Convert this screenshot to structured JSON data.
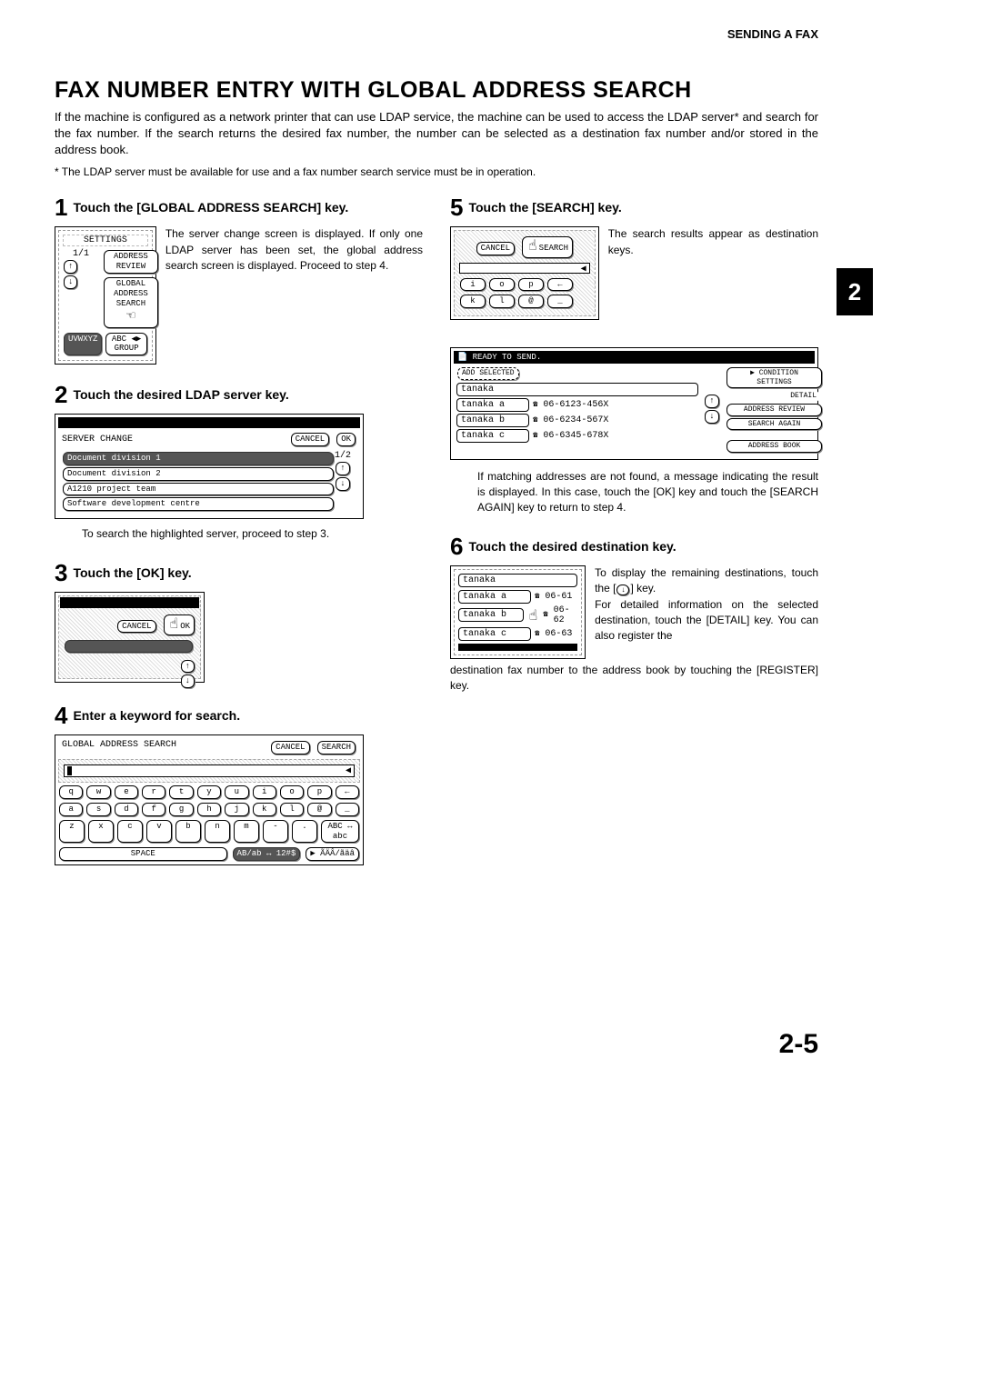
{
  "header": "SENDING A FAX",
  "title": "FAX NUMBER ENTRY WITH GLOBAL ADDRESS SEARCH",
  "intro1": "If the machine is configured as a network printer that can use LDAP service, the machine can be used to access the LDAP server* and search for the fax number. If the search returns the desired fax number, the number can be selected as a destination fax number and/or stored in the address book.",
  "intro2": "* The LDAP server must be available for use and a fax number search service must be in operation.",
  "sideTab": "2",
  "pageNumber": "2-5",
  "steps": {
    "s1": {
      "num": "1",
      "title": "Touch the [GLOBAL ADDRESS SEARCH] key.",
      "text": "The server change screen is displayed. If only one LDAP server has been set, the global address search screen is displayed. Proceed to step 4.",
      "scr": {
        "settings": "SETTINGS",
        "page": "1/1",
        "addrReview": "ADDRESS REVIEW",
        "global": "GLOBAL ADDRESS SEARCH",
        "uvwxyz": "UVWXYZ",
        "abc": "ABC",
        "group": "GROUP"
      }
    },
    "s2": {
      "num": "2",
      "title": "Touch the desired LDAP server key.",
      "text": "To search the highlighted server, proceed to step 3.",
      "scr": {
        "title": "SERVER CHANGE",
        "cancel": "CANCEL",
        "ok": "OK",
        "page": "1/2",
        "items": [
          "Document division 1",
          "Document division 2",
          "A1210 project team",
          "Software development centre"
        ]
      }
    },
    "s3": {
      "num": "3",
      "title": "Touch the [OK] key.",
      "scr": {
        "cancel": "CANCEL",
        "ok": "OK"
      }
    },
    "s4": {
      "num": "4",
      "title": "Enter a keyword for search.",
      "scr": {
        "title": "GLOBAL ADDRESS SEARCH",
        "cancel": "CANCEL",
        "search": "SEARCH",
        "rows": [
          [
            "q",
            "w",
            "e",
            "r",
            "t",
            "y",
            "u",
            "i",
            "o",
            "p",
            "←"
          ],
          [
            "a",
            "s",
            "d",
            "f",
            "g",
            "h",
            "j",
            "k",
            "l",
            "@",
            "_"
          ],
          [
            "z",
            "x",
            "c",
            "v",
            "b",
            "n",
            "m",
            "-",
            ".",
            "ABC ↔ abc"
          ]
        ],
        "space": "SPACE",
        "toggle1": "AB/ab ↔ 12#$",
        "toggle2": "▶ ÃÄÂ/ãäâ"
      }
    },
    "s5": {
      "num": "5",
      "title": "Touch the [SEARCH] key.",
      "text": "The search results appear as destination keys.",
      "scr": {
        "cancel": "CANCEL",
        "search": "SEARCH",
        "keys": [
          "i",
          "o",
          "p",
          "←",
          "k",
          "l",
          "@",
          "_"
        ]
      },
      "res": {
        "status": "READY TO SEND.",
        "addSel": "ADD SELECTED",
        "cond": "CONDITION SETTINGS",
        "query": "tanaka",
        "detail": "DETAIL",
        "addrReview": "ADDRESS REVIEW",
        "searchAgain": "SEARCH AGAIN",
        "addrBook": "ADDRESS BOOK",
        "rows": [
          {
            "n": "tanaka a",
            "p": "06-6123-456X"
          },
          {
            "n": "tanaka b",
            "p": "06-6234-567X"
          },
          {
            "n": "tanaka c",
            "p": "06-6345-678X"
          }
        ]
      },
      "after": "If matching addresses are not found, a message indicating the result is displayed. In this case, touch the [OK] key and touch the [SEARCH AGAIN] key to return to step 4."
    },
    "s6": {
      "num": "6",
      "title": "Touch the desired destination key.",
      "text1": "To display the remaining destinations, touch the [",
      "text1b": "] key.",
      "text2": "For detailed information on the selected destination, touch the [DETAIL] key. You can also register the destination fax number to the address book by touching the [REGISTER] key.",
      "scr": {
        "query": "tanaka",
        "rows": [
          {
            "n": "tanaka a",
            "p": "06-61"
          },
          {
            "n": "tanaka b",
            "p": "06-62"
          },
          {
            "n": "tanaka c",
            "p": "06-63"
          }
        ]
      }
    }
  }
}
